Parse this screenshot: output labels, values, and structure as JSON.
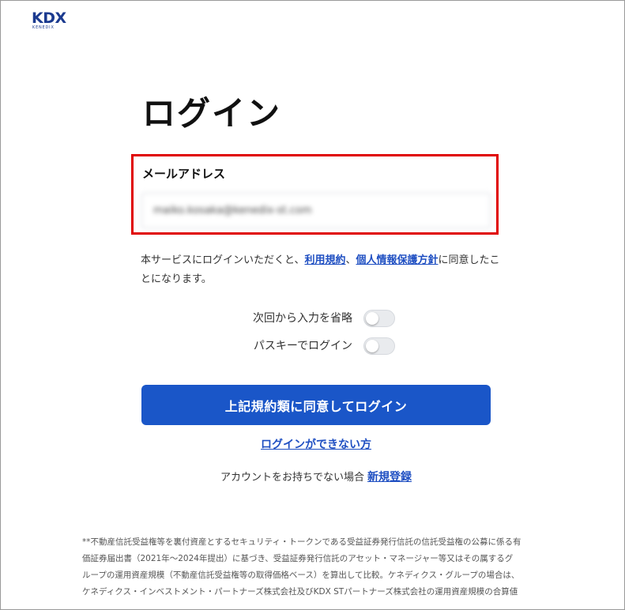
{
  "brand": {
    "logo_text": "KDX",
    "logo_subtext": "KENEDIX"
  },
  "page_title": "ログイン",
  "email": {
    "label": "メールアドレス",
    "value": "maiko.kosaka@kenedix-st.com"
  },
  "consent": {
    "text_before": "本サービスにログインいただくと、",
    "terms_link": "利用規約",
    "separator": "、",
    "privacy_link": "個人情報保護方針",
    "text_after": "に同意したことになります。"
  },
  "toggles": [
    {
      "label": "次回から入力を省略",
      "on": false
    },
    {
      "label": "パスキーでログイン",
      "on": false
    }
  ],
  "login_button": "上記規約類に同意してログイン",
  "trouble_link": "ログインができない方",
  "signup": {
    "prompt": "アカウントをお持ちでない場合",
    "link": "新規登録"
  },
  "footnote_lines": [
    "**不動産信託受益権等を裏付資産とするセキュリティ・トークンである受益証券発行信託の信託受益権の公募に係る有",
    "価証券届出書（2021年〜2024年提出）に基づき、受益証券発行信託のアセット・マネージャー等又はその属するグ",
    "ループの運用資産規模（不動産信託受益権等の取得価格ベース）を算出して比較。ケネディクス・グループの場合は、",
    "ケネディクス・インベストメント・パートナーズ株式会社及びKDX STパートナーズ株式会社の運用資産規模の合算値"
  ],
  "colors": {
    "accent": "#1a56c8",
    "link": "#1f4fc2",
    "highlight": "#e00000",
    "logo": "#1b3a8f"
  }
}
